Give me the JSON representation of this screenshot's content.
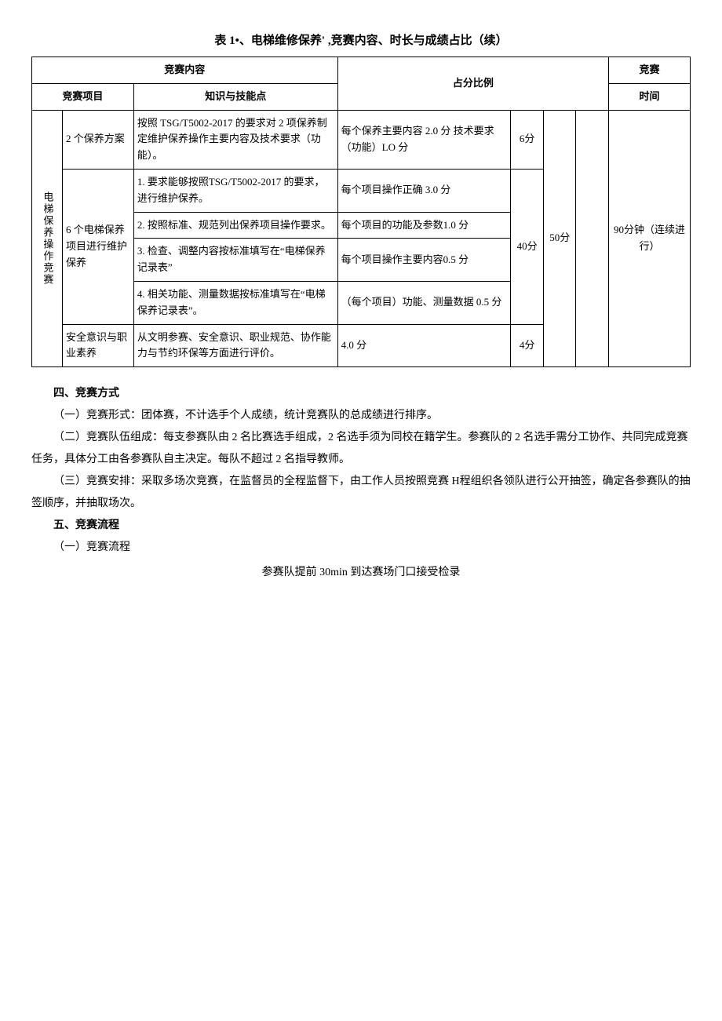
{
  "table_title": "表 1•、电梯维修保养' ,竞赛内容、时长与成绩占比（续）",
  "headers": {
    "content": "竞赛内容",
    "ratio": "占分比例",
    "time": "竞赛",
    "subject": "竞赛项目",
    "knowledge": "知识与技能点",
    "time_sub": "时间"
  },
  "col0": "电梯保养操作竞赛",
  "rows": {
    "r1": {
      "item": "2 个保养方案",
      "knowledge": "按照 TSG/T5002-2017 的要求对 2 项保养制定维护保养操作主要内容及技术要求（功能）。",
      "criteria": "每个保养主要内容 2.0 分  技术要求（功能）LO 分",
      "score": "6分"
    },
    "r2": {
      "item": "6 个电梯保养项目进行维护保养",
      "knowledge": "1. 要求能够按照TSG/T5002-2017 的要求，进行维护保养。",
      "criteria": "每个项目操作正确 3.0 分"
    },
    "r3": {
      "knowledge": "2. 按照标准、规范列出保养项目操作要求。",
      "criteria": "每个项目的功能及参数1.0 分"
    },
    "r4": {
      "knowledge": "3. 检查、调整内容按标准填写在“电梯保养记录表”",
      "criteria": "每个项目操作主要内容0.5 分"
    },
    "r5": {
      "knowledge": "4. 相关功能、测量数据按标准填写在“电梯保养记录表”。",
      "criteria": "（每个项目）功能、测量数据 0.5 分"
    },
    "r6": {
      "item": "安全意识与职业素养",
      "knowledge": "从文明参赛、安全意识、职业规范、协作能力与节约环保等方面进行评价。",
      "criteria": "4.0 分",
      "score": "4分"
    }
  },
  "midscore": "40分",
  "totalscore": "50分",
  "time_text": "90分钟（连续进行）",
  "body": {
    "h1": "四、竞赛方式",
    "p1": "（一）竞赛形式：团体赛，不计选手个人成绩，统计竞赛队的总成绩进行排序。",
    "p2": "（二）竞赛队伍组成：每支参赛队由 2 名比赛选手组成，2 名选手须为同校在籍学生。参赛队的 2 名选手需分工协作、共同完成竞赛任务，具体分工由各参赛队自主决定。每队不超过 2 名指导教师。",
    "p3": "（三）竞赛安排：采取多场次竞赛，在监督员的全程监督下，由工作人员按照竞赛 H程组织各领队进行公开抽签，确定各参赛队的抽签顺序，并抽取场次。",
    "h2": "五、竞赛流程",
    "p4": "（一）竞赛流程",
    "p5": "参赛队提前 30min 到达赛场门口接受检录"
  }
}
